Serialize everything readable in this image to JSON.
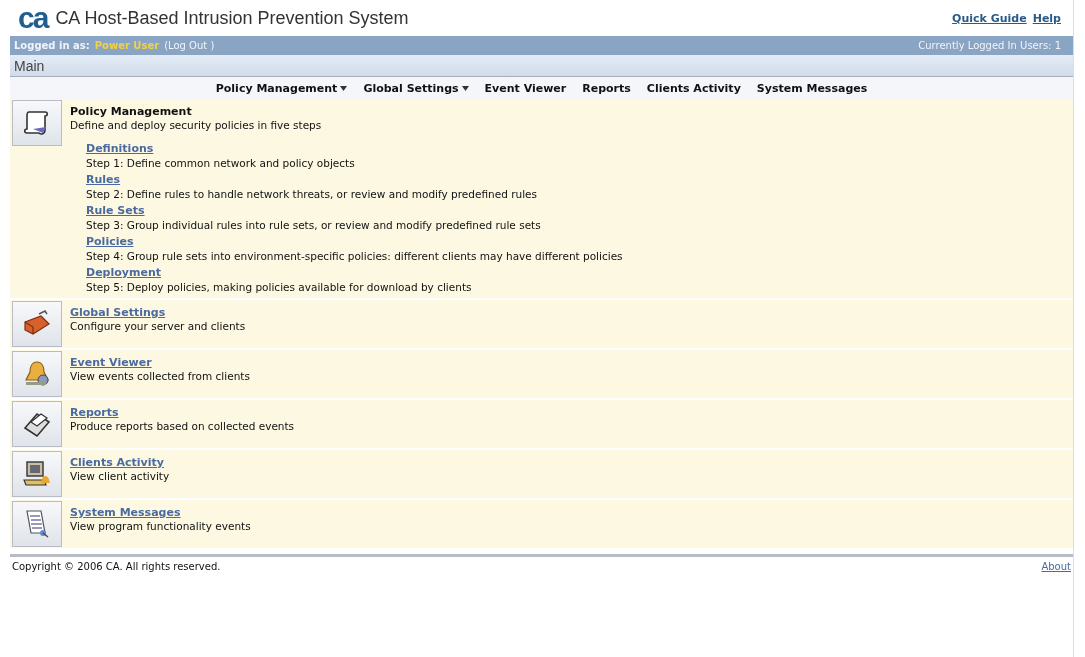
{
  "header": {
    "logo": "ca",
    "title": "CA Host-Based Intrusion Prevention System",
    "links": [
      "Quick Guide",
      "Help"
    ]
  },
  "login_bar": {
    "label": "Logged in as:",
    "user": "Power User",
    "logout": "(Log Out )",
    "users": "Currently Logged In Users: 1"
  },
  "breadcrumb": "Main",
  "nav": [
    {
      "label": "Policy Management",
      "dropdown": true
    },
    {
      "label": "Global Settings",
      "dropdown": true
    },
    {
      "label": "Event Viewer",
      "dropdown": false
    },
    {
      "label": "Reports",
      "dropdown": false
    },
    {
      "label": "Clients Activity",
      "dropdown": false
    },
    {
      "label": "System Messages",
      "dropdown": false
    }
  ],
  "sections": [
    {
      "kind": "policy",
      "title": "Policy Management",
      "link": false,
      "description": "Define and deploy security policies in five steps",
      "steps": [
        {
          "link": "Definitions",
          "text": "Step 1: Define common network and policy objects"
        },
        {
          "link": "Rules",
          "text": "Step 2: Define rules to handle network threats, or review and modify predefined rules"
        },
        {
          "link": "Rule Sets",
          "text": "Step 3: Group individual rules into rule sets, or review and modify predefined rule sets"
        },
        {
          "link": "Policies",
          "text": "Step 4: Group rule sets into environment-specific policies: different clients may have different policies"
        },
        {
          "link": "Deployment",
          "text": "Step 5: Deploy policies, making policies available for download by clients"
        }
      ]
    },
    {
      "kind": "settings",
      "title": "Global Settings",
      "link": true,
      "description": "Configure your server and clients"
    },
    {
      "kind": "events",
      "title": "Event Viewer",
      "link": true,
      "description": "View events collected from clients"
    },
    {
      "kind": "reports",
      "title": "Reports",
      "link": true,
      "description": "Produce reports based on collected events"
    },
    {
      "kind": "clients",
      "title": "Clients Activity",
      "link": true,
      "description": "View client activity"
    },
    {
      "kind": "messages",
      "title": "System Messages",
      "link": true,
      "description": "View program functionality events"
    }
  ],
  "footer": {
    "copyright": "Copyright © 2006 CA. All rights reserved.",
    "about": "About"
  }
}
